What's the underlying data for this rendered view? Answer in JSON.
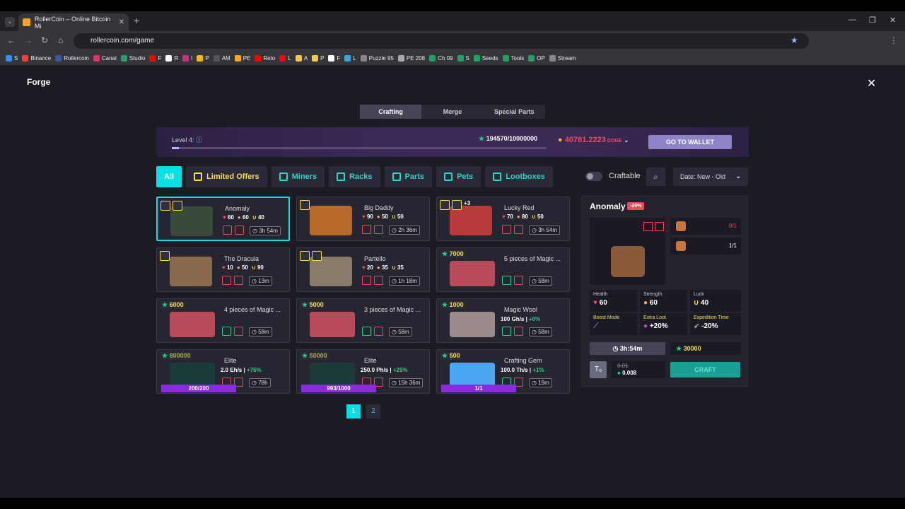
{
  "browser": {
    "tab_title": "RollerCoin – Online Bitcoin Mi",
    "url": "rollercoin.com/game",
    "bookmarks": [
      "S",
      "Binance",
      "Rollercoin",
      "Canal",
      "Studio",
      "F",
      "R",
      "I",
      "P",
      "AM",
      "PE",
      "Reto",
      "L",
      "A",
      "P",
      "F",
      "L",
      "Puzzle 95",
      "PE 208",
      "Ch 09",
      "S",
      "Seeds",
      "Tools",
      "OP",
      "Stream"
    ]
  },
  "page": {
    "title": "Forge",
    "tabs": [
      "Crafting",
      "Merge",
      "Special Parts"
    ]
  },
  "banner": {
    "level": "Level 4:",
    "xp": "194570/10000000",
    "balance": "40781.2223",
    "currency": "DOGE",
    "wallet_btn": "GO TO WALLET",
    "progress": 0.019
  },
  "filters": {
    "items": [
      "All",
      "Limited Offers",
      "Miners",
      "Racks",
      "Parts",
      "Pets",
      "Lootboxes"
    ],
    "craftable": "Craftable",
    "sort": "Date: New - Old"
  },
  "cards": [
    {
      "name": "Anomaly",
      "h": "60",
      "s": "60",
      "l": "40",
      "time": "3h 54m"
    },
    {
      "name": "Big Daddy",
      "h": "90",
      "s": "50",
      "l": "50",
      "time": "2h 36m"
    },
    {
      "name": "Lucky Red",
      "h": "70",
      "s": "80",
      "l": "50",
      "time": "3h 54m",
      "extra": "+3"
    },
    {
      "name": "The Dracula",
      "h": "10",
      "s": "50",
      "l": "90",
      "time": "13m"
    },
    {
      "name": "Partello",
      "h": "20",
      "s": "35",
      "l": "35",
      "time": "1h 18m"
    },
    {
      "name": "5 pieces of Magic ...",
      "price": "7000",
      "time": "58m"
    },
    {
      "name": "4 pieces of Magic ...",
      "price": "6000",
      "time": "58m"
    },
    {
      "name": "3 pieces of Magic ...",
      "price": "5000",
      "time": "58m"
    },
    {
      "name": "Magic Wool",
      "price": "1000",
      "power": "100 Gh/s",
      "bonus": "+0%",
      "time": "58m"
    },
    {
      "name": "Elite",
      "price": "800000",
      "power": "2.0 Eh/s",
      "bonus": "+75%",
      "time": "78h",
      "progress": "200/200"
    },
    {
      "name": "Elite",
      "price": "50000",
      "power": "250.0 Ph/s",
      "bonus": "+25%",
      "time": "15h 36m",
      "progress": "993/1000"
    },
    {
      "name": "Crafting Gem",
      "price": "500",
      "power": "100.0 Th/s",
      "bonus": "+1%",
      "time": "19m",
      "progress": "1/1"
    }
  ],
  "pagination": [
    "1",
    "2"
  ],
  "detail": {
    "name": "Anomaly",
    "discount": "-20%",
    "materials": [
      "0/1",
      "1/1"
    ],
    "health_label": "Health",
    "health": "60",
    "strength_label": "Strength",
    "strength": "60",
    "luck_label": "Luck",
    "luck": "40",
    "boost_label": "Boost Mode",
    "loot_label": "Extra Loot",
    "loot": "+20%",
    "exp_label": "Expedition Time",
    "exp": "-20%",
    "time": "3h:54m",
    "xp": "30000",
    "old_cost": "0.01",
    "cost": "0.008",
    "craft_btn": "CRAFT"
  },
  "colors": {
    "accent": "#03e1e4",
    "gold": "#f7dd46",
    "red": "#f04a5a",
    "green": "#23d18b"
  }
}
